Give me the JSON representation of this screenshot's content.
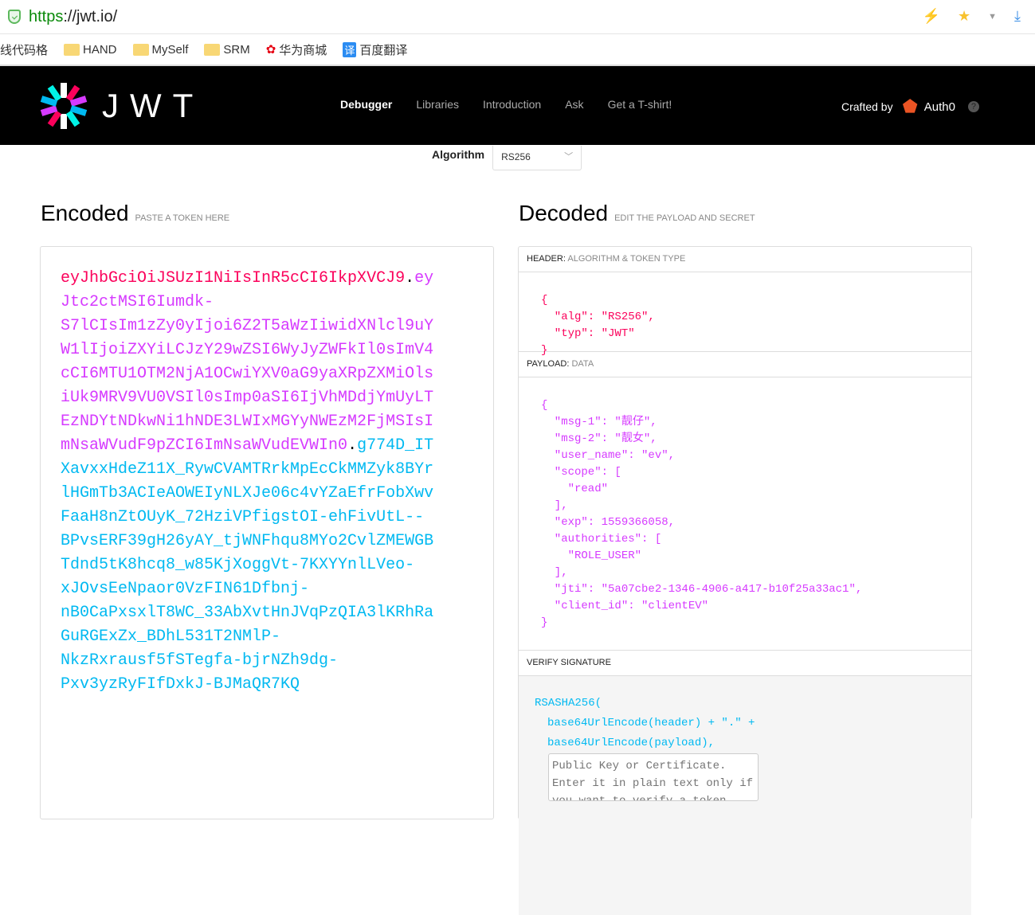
{
  "browser": {
    "url_scheme": "https",
    "url_rest": "://jwt.io/",
    "bookmarks": [
      "E线代码格",
      "HAND",
      "MySelf",
      "SRM",
      "华为商城",
      "百度翻译"
    ]
  },
  "nav": {
    "logo": "JWT",
    "items": [
      "Debugger",
      "Libraries",
      "Introduction",
      "Ask",
      "Get a T-shirt!"
    ],
    "crafted_by": "Crafted by",
    "brand": "Auth0",
    "help": "?"
  },
  "algorithm": {
    "label": "Algorithm",
    "value": "RS256"
  },
  "encoded": {
    "title": "Encoded",
    "subtitle": "PASTE A TOKEN HERE",
    "header": "eyJhbGciOiJSUzI1NiIsInR5cCI6IkpXVCJ9",
    "payload": "eyJtc2ctMSI6Iumdk-S7lCIsIm1zZy0yIjoi6Z2T5aWzIiwidXNlcl9uYW1lIjoiZXYiLCJzY29wZSI6WyJyZWFkIl0sImV4cCI6MTU1OTM2NjA1OCwiYXV0aG9yaXRpZXMiOlsiUk9MRV9VU0VSIl0sImp0aSI6IjVhMDdjYmUyLTEzNDYtNDkwNi1hNDE3LWIxMGYyNWEzM2FjMSIsImNsaWVudF9pZCI6ImNsaWVudEVWIn0",
    "signature": "g774D_ITXavxxHdeZ11X_RywCVAMTRrkMpEcCkMMZyk8BYrlHGmTb3ACIeAOWEIyNLXJe06c4vYZaEfrFobXwvFaaH8nZtOUyK_72HziVPfigstOI-ehFivUtL--BPvsERF39gH26yAY_tjWNFhqu8MYo2CvlZMEWGBTdnd5tK8hcq8_w85KjXoggVt-7KXYYnlLVeo-xJOvsEeNpaor0VzFIN61Dfbnj-nB0CaPxsxlT8WC_33AbXvtHnJVqPzQIA3lKRhRaGuRGExZx_BDhL531T2NMlP-NkzRxrausf5fSTegfa-bjrNZh9dg-Pxv3yzRyFIfDxkJ-BJMaQR7KQ"
  },
  "decoded": {
    "title": "Decoded",
    "subtitle": "EDIT THE PAYLOAD AND SECRET",
    "header_label": "HEADER:",
    "header_desc": "ALGORITHM & TOKEN TYPE",
    "header_json": "{\n  \"alg\": \"RS256\",\n  \"typ\": \"JWT\"\n}",
    "payload_label": "PAYLOAD:",
    "payload_desc": "DATA",
    "payload_json": "{\n  \"msg-1\": \"靓仔\",\n  \"msg-2\": \"靓女\",\n  \"user_name\": \"ev\",\n  \"scope\": [\n    \"read\"\n  ],\n  \"exp\": 1559366058,\n  \"authorities\": [\n    \"ROLE_USER\"\n  ],\n  \"jti\": \"5a07cbe2-1346-4906-a417-b10f25a33ac1\",\n  \"client_id\": \"clientEV\"\n}",
    "verify_label": "VERIFY SIGNATURE",
    "sig_fn": "RSASHA256(",
    "sig_l1": "base64UrlEncode(header) + \".\" +",
    "sig_l2": "base64UrlEncode(payload),",
    "key_placeholder": "Public Key or Certificate. Enter it in plain text only if you want to verify a token"
  },
  "colors": {
    "header": "#fb015b",
    "payload": "#d63aff",
    "signature": "#00b9f1"
  }
}
